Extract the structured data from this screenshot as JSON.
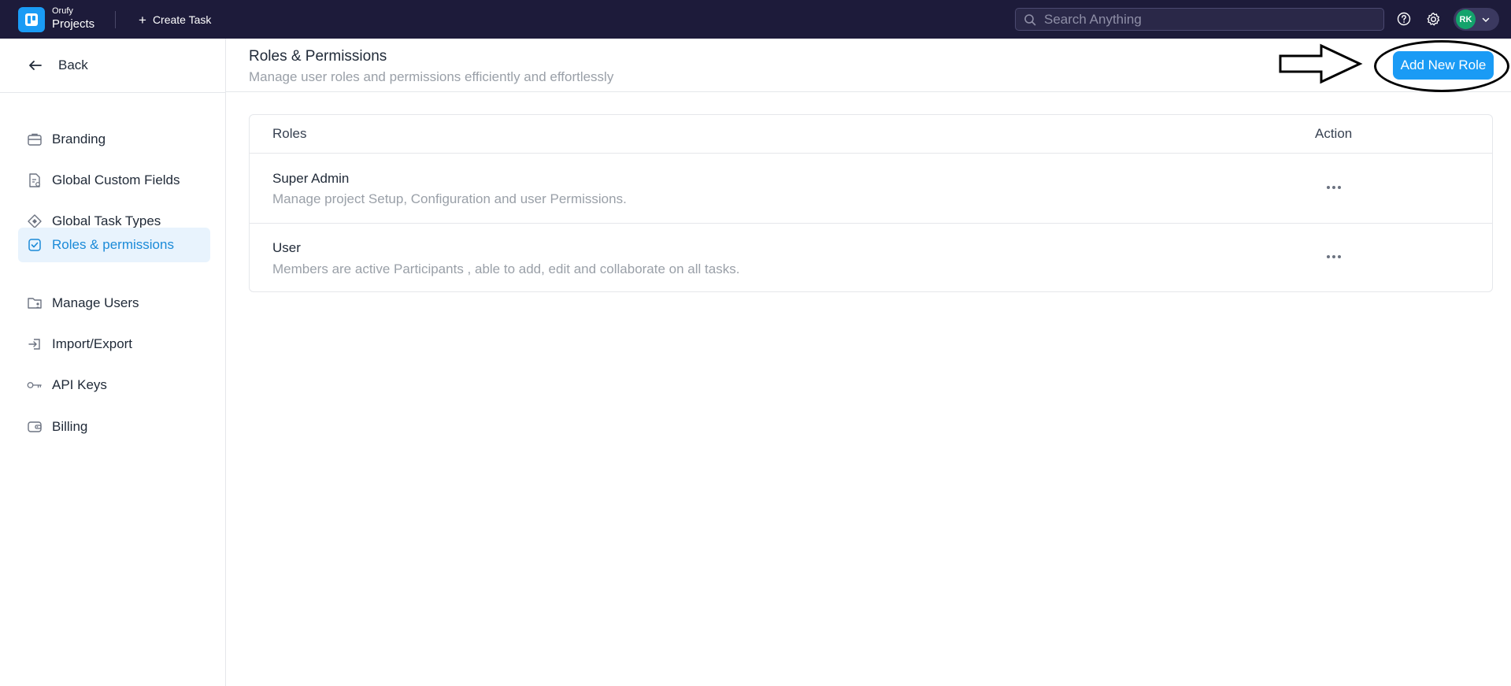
{
  "topbar": {
    "brand_small": "Orufy",
    "brand_big": "Projects",
    "create_task_label": "Create Task",
    "search_placeholder": "Search Anything",
    "avatar_initials": "RK"
  },
  "sidebar": {
    "back_label": "Back",
    "items": [
      {
        "label": "Branding",
        "icon": "briefcase-icon"
      },
      {
        "label": "Global Custom Fields",
        "icon": "document-settings-icon"
      },
      {
        "label": "Global Task Types",
        "icon": "diamond-icon"
      },
      {
        "label": "Roles & permissions",
        "icon": "checkbox-icon",
        "active": true
      },
      {
        "label": "Manage Users",
        "icon": "folder-user-icon"
      },
      {
        "label": "Import/Export",
        "icon": "import-icon"
      },
      {
        "label": "API Keys",
        "icon": "key-icon"
      },
      {
        "label": "Billing",
        "icon": "wallet-icon"
      }
    ]
  },
  "header": {
    "title": "Roles & Permissions",
    "subtitle": "Manage user roles and permissions efficiently and effortlessly",
    "add_button_label": "Add New Role"
  },
  "table": {
    "columns": [
      "Roles",
      "Action"
    ],
    "rows": [
      {
        "name": "Super Admin",
        "description": "Manage project Setup, Configuration and user Permissions."
      },
      {
        "name": "User",
        "description": "Members are active Participants , able to add, edit and collaborate on all tasks."
      }
    ]
  },
  "colors": {
    "topbar_bg": "#1d1b3a",
    "accent": "#1a9bf5",
    "active_bg": "#e8f3fd",
    "avatar_bg": "#13a36b"
  }
}
